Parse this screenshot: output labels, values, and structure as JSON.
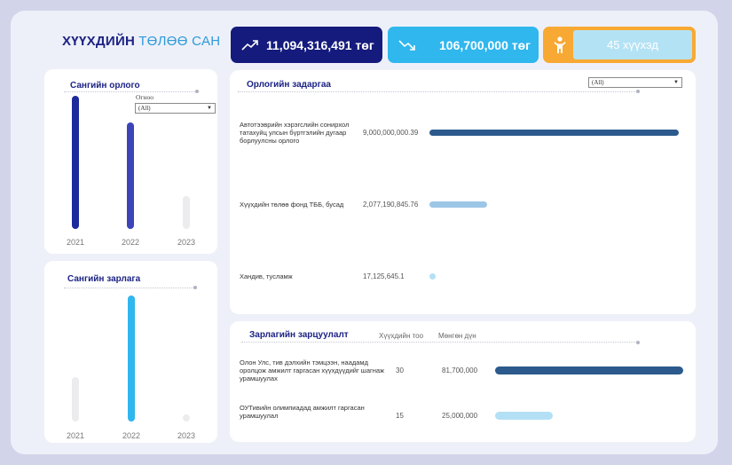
{
  "title": {
    "part1": "ХҮҮХДИЙН",
    "part2": "ТӨЛӨӨ САН"
  },
  "kpis": {
    "income": "11,094,316,491 төг",
    "expense": "106,700,000 төг",
    "children": "45 хүүхэд"
  },
  "fund_income": {
    "title": "Сангийн орлого",
    "filter_label": "Огноо",
    "filter_value": "(All)",
    "bars": [
      {
        "year": "2021",
        "value": 100
      },
      {
        "year": "2022",
        "value": 80
      },
      {
        "year": "2023",
        "value": 25
      }
    ]
  },
  "fund_expense": {
    "title": "Сангийн зарлага",
    "bars": [
      {
        "year": "2021",
        "value": 35
      },
      {
        "year": "2022",
        "value": 100
      },
      {
        "year": "2023",
        "value": 5
      }
    ]
  },
  "income_breakdown": {
    "title": "Орлогийн задаргаа",
    "filter_value": "(All)",
    "rows": [
      {
        "label": "Автотээврийн хэрэгслийн сонирхол татахуйц улсын бүртгэлийн дугаар борлуулсны орлого",
        "amount": "9,000,000,000.39",
        "value": 9000000000.39
      },
      {
        "label": "Хүүхдийн төлөө фонд ТББ, бусад",
        "amount": "2,077,190,845.76",
        "value": 2077190845.76
      },
      {
        "label": "Хандив, тусламж",
        "amount": "17,125,645.1",
        "value": 17125645.1
      }
    ]
  },
  "expense_allocation": {
    "title": "Зарлагийн зарцуулалт",
    "col_children": "Хүүхдийн тоо",
    "col_amount": "Мөнгөн дүн",
    "rows": [
      {
        "label": "Олон Улс, тив дэлхийн тэмцээн, наадамд оролцож амжилт гаргасан хүүхдүүдийг шагнаж урамшуулах",
        "children": "30",
        "amount": "81,700,000",
        "value": 81700000
      },
      {
        "label": "ОУТивийн олимпиадад амжилт гаргасан урамшуулал",
        "children": "15",
        "amount": "25,000,000",
        "value": 25000000
      }
    ]
  },
  "colors": {
    "navy": "#141b7c",
    "income_bar_dark": "#1c2a9c",
    "income_bar_mid": "#3b45b8",
    "bar_grey": "#ececef",
    "sky": "#2fb7ee",
    "orange": "#f7a933",
    "hbar_dark": "#2c5a8c",
    "hbar_light": "#9dc6e6",
    "hbar_pale": "#b4e0f5"
  },
  "icons": {
    "up": "trend-up-icon",
    "down": "trend-down-icon",
    "child": "child-icon"
  }
}
